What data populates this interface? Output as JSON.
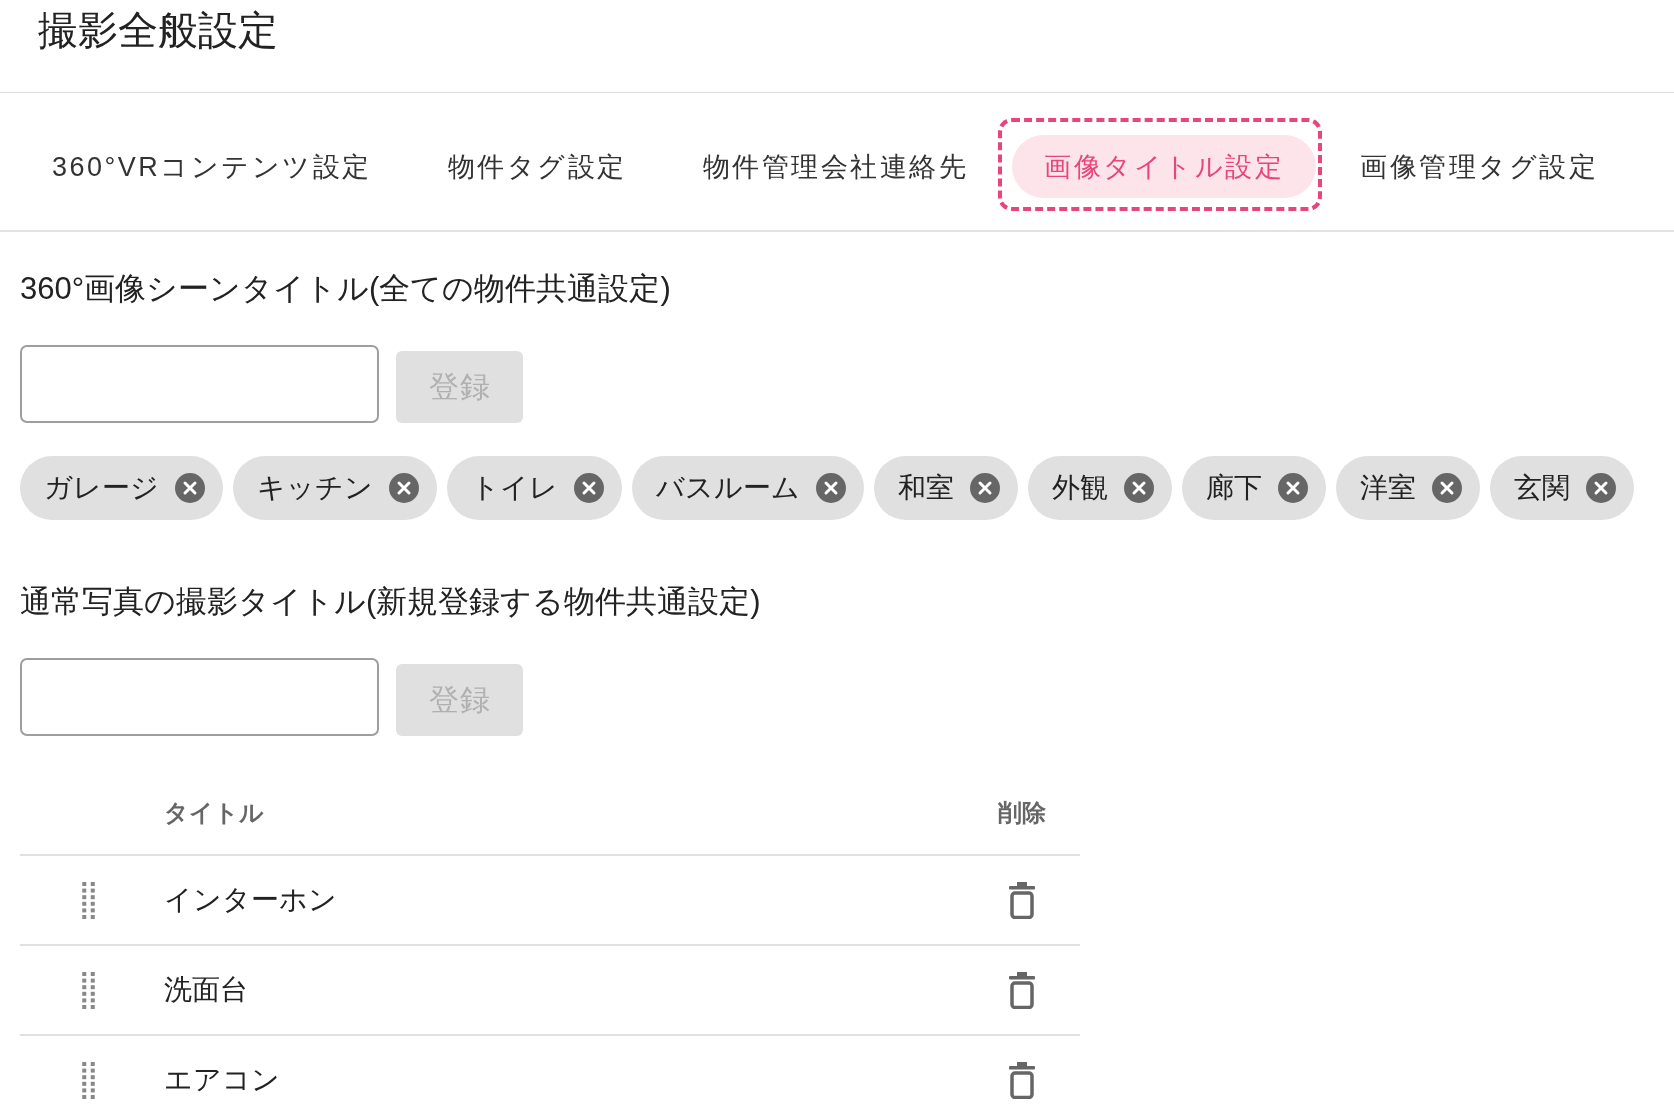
{
  "page_title": "撮影全般設定",
  "tabs": [
    {
      "label": "360°VRコンテンツ設定",
      "selected": false
    },
    {
      "label": "物件タグ設定",
      "selected": false
    },
    {
      "label": "物件管理会社連絡先",
      "selected": false
    },
    {
      "label": "画像タイトル設定",
      "selected": true
    },
    {
      "label": "画像管理タグ設定",
      "selected": false
    }
  ],
  "scene_titles": {
    "heading": "360°画像シーンタイトル(全ての物件共通設定)",
    "register_button": {
      "label": "登録",
      "disabled": true
    },
    "chips": [
      "ガレージ",
      "キッチン",
      "トイレ",
      "バスルーム",
      "和室",
      "外観",
      "廊下",
      "洋室",
      "玄関"
    ]
  },
  "photo_titles": {
    "heading": "通常写真の撮影タイトル(新規登録する物件共通設定)",
    "register_button": {
      "label": "登録",
      "disabled": true
    },
    "table": {
      "columns": [
        "タイトル",
        "削除"
      ],
      "rows": [
        {
          "title": "インターホン"
        },
        {
          "title": "洗面台"
        },
        {
          "title": "エアコン"
        }
      ]
    }
  }
}
